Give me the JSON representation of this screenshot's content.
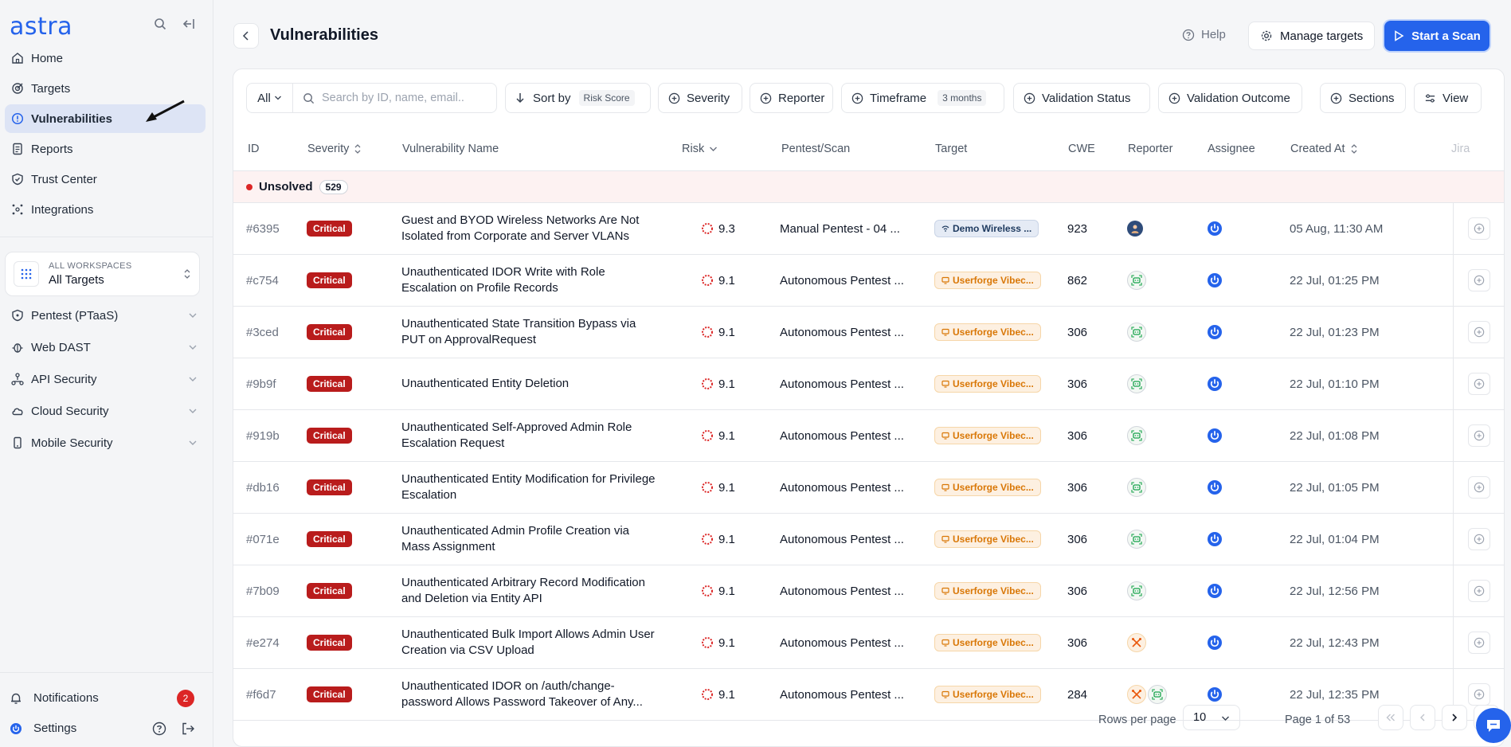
{
  "app": {
    "logo": "astra"
  },
  "sidebar": {
    "nav": [
      {
        "label": "Home",
        "icon": "home-icon"
      },
      {
        "label": "Targets",
        "icon": "target-icon"
      },
      {
        "label": "Vulnerabilities",
        "icon": "alert-circle-icon",
        "active": true
      },
      {
        "label": "Reports",
        "icon": "report-icon"
      },
      {
        "label": "Trust Center",
        "icon": "shield-check-icon"
      },
      {
        "label": "Integrations",
        "icon": "integrations-icon"
      }
    ],
    "workspace": {
      "small": "ALL WORKSPACES",
      "big": "All Targets"
    },
    "groups": [
      {
        "label": "Pentest (PTaaS)",
        "icon": "shield-icon"
      },
      {
        "label": "Web DAST",
        "icon": "bug-icon"
      },
      {
        "label": "API Security",
        "icon": "api-icon"
      },
      {
        "label": "Cloud Security",
        "icon": "cloud-icon"
      },
      {
        "label": "Mobile Security",
        "icon": "mobile-icon"
      }
    ],
    "notifications": {
      "label": "Notifications",
      "count": "2"
    },
    "settings": {
      "label": "Settings"
    }
  },
  "header": {
    "title": "Vulnerabilities",
    "help": "Help",
    "manage": "Manage targets",
    "start": "Start a Scan"
  },
  "toolbar": {
    "all": "All",
    "search_placeholder": "Search by ID, name, email..",
    "sort_label": "Sort by",
    "sort_value": "Risk Score",
    "severity": "Severity",
    "reporter": "Reporter",
    "timeframe": "Timeframe",
    "timeframe_value": "3 months",
    "validation_status": "Validation Status",
    "validation_outcome": "Validation Outcome",
    "sections": "Sections",
    "view": "View"
  },
  "columns": {
    "id": "ID",
    "severity": "Severity",
    "name": "Vulnerability Name",
    "risk": "Risk",
    "pentest": "Pentest/Scan",
    "target": "Target",
    "cwe": "CWE",
    "reporter": "Reporter",
    "assignee": "Assignee",
    "created": "Created At",
    "jira": "Jira"
  },
  "group": {
    "label": "Unsolved",
    "count": "529"
  },
  "rows": [
    {
      "id": "#6395",
      "severity": "Critical",
      "name": "Guest and BYOD Wireless Networks Are Not Isolated from Corporate and Server VLANs",
      "risk": "9.3",
      "pentest": "Manual Pentest - 04 ...",
      "target": "Demo Wireless ...",
      "target_kind": "blue",
      "cwe": "923",
      "reporter": "avatar",
      "created": "05 Aug, 11:30 AM"
    },
    {
      "id": "#c754",
      "severity": "Critical",
      "name": "Unauthenticated IDOR Write with Role Escalation on Profile Records",
      "risk": "9.1",
      "pentest": "Autonomous Pentest ...",
      "target": "Userforge Vibec...",
      "target_kind": "orange",
      "cwe": "862",
      "reporter": "bot",
      "created": "22 Jul, 01:25 PM"
    },
    {
      "id": "#3ced",
      "severity": "Critical",
      "name": "Unauthenticated State Transition Bypass via PUT on ApprovalRequest",
      "risk": "9.1",
      "pentest": "Autonomous Pentest ...",
      "target": "Userforge Vibec...",
      "target_kind": "orange",
      "cwe": "306",
      "reporter": "bot",
      "created": "22 Jul, 01:23 PM"
    },
    {
      "id": "#9b9f",
      "severity": "Critical",
      "name": "Unauthenticated Entity Deletion",
      "risk": "9.1",
      "pentest": "Autonomous Pentest ...",
      "target": "Userforge Vibec...",
      "target_kind": "orange",
      "cwe": "306",
      "reporter": "bot",
      "created": "22 Jul, 01:10 PM"
    },
    {
      "id": "#919b",
      "severity": "Critical",
      "name": "Unauthenticated Self-Approved Admin Role Escalation Request",
      "risk": "9.1",
      "pentest": "Autonomous Pentest ...",
      "target": "Userforge Vibec...",
      "target_kind": "orange",
      "cwe": "306",
      "reporter": "bot",
      "created": "22 Jul, 01:08 PM"
    },
    {
      "id": "#db16",
      "severity": "Critical",
      "name": "Unauthenticated Entity Modification for Privilege Escalation",
      "risk": "9.1",
      "pentest": "Autonomous Pentest ...",
      "target": "Userforge Vibec...",
      "target_kind": "orange",
      "cwe": "306",
      "reporter": "bot",
      "created": "22 Jul, 01:05 PM"
    },
    {
      "id": "#071e",
      "severity": "Critical",
      "name": "Unauthenticated Admin Profile Creation via Mass Assignment",
      "risk": "9.1",
      "pentest": "Autonomous Pentest ...",
      "target": "Userforge Vibec...",
      "target_kind": "orange",
      "cwe": "306",
      "reporter": "bot",
      "created": "22 Jul, 01:04 PM"
    },
    {
      "id": "#7b09",
      "severity": "Critical",
      "name": "Unauthenticated Arbitrary Record Modification and Deletion via Entity API",
      "risk": "9.1",
      "pentest": "Autonomous Pentest ...",
      "target": "Userforge Vibec...",
      "target_kind": "orange",
      "cwe": "306",
      "reporter": "bot",
      "created": "22 Jul, 12:56 PM"
    },
    {
      "id": "#e274",
      "severity": "Critical",
      "name": "Unauthenticated Bulk Import Allows Admin User Creation via CSV Upload",
      "risk": "9.1",
      "pentest": "Autonomous Pentest ...",
      "target": "Userforge Vibec...",
      "target_kind": "orange",
      "cwe": "306",
      "reporter": "tools",
      "created": "22 Jul, 12:43 PM"
    },
    {
      "id": "#f6d7",
      "severity": "Critical",
      "name": "Unauthenticated IDOR on /auth/change-password Allows Password Takeover of Any...",
      "risk": "9.1",
      "pentest": "Autonomous Pentest ...",
      "target": "Userforge Vibec...",
      "target_kind": "orange",
      "cwe": "284",
      "reporter": "tools+bot",
      "created": "22 Jul, 12:35 PM"
    }
  ],
  "footer": {
    "rows_per_page_label": "Rows per page",
    "rows_per_page": "10",
    "page_info": "Page 1 of 53"
  },
  "colors": {
    "accent": "#2563eb",
    "critical": "#b91c1c",
    "target_orange": "#d97706"
  }
}
